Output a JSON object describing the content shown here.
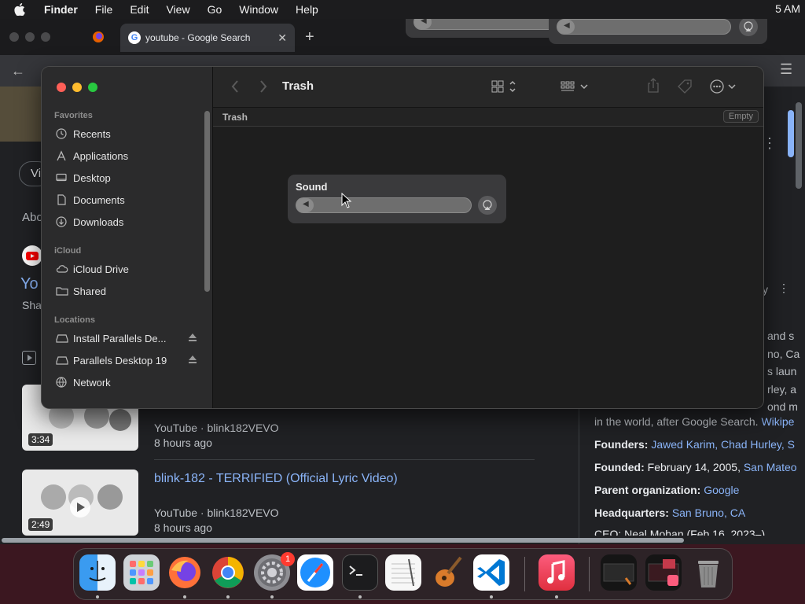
{
  "menubar": {
    "app_name": "Finder",
    "items": [
      "File",
      "Edit",
      "View",
      "Go",
      "Window",
      "Help"
    ],
    "clock": "5 AM"
  },
  "chrome": {
    "tab_title": "youtube - Google Search",
    "partial_texts": {
      "vi": "Vi",
      "abo": "Abo",
      "yo": "Yo",
      "sha": "Sha",
      "right_y": "y",
      "kp_lines": [
        "and s",
        "no, Ca",
        "s laun",
        "rley, a",
        "ond m"
      ]
    },
    "results": [
      {
        "title": "",
        "source": "YouTube · blink182VEVO",
        "age": "8 hours ago",
        "duration": "3:34"
      },
      {
        "title": "blink-182 - TERRIFIED (Official Lyric Video)",
        "source": "YouTube · blink182VEVO",
        "age": "8 hours ago",
        "duration": "2:49"
      }
    ],
    "knowledge_panel": {
      "desc_end": "in the world, after Google Search.",
      "desc_link": "Wikipe",
      "founders_label": "Founders:",
      "founders": "Jawed Karim, Chad Hurley, S",
      "founded_label": "Founded:",
      "founded": "February 14, 2005,",
      "founded_link": "San Mateo",
      "parent_label": "Parent organization:",
      "parent": "Google",
      "hq_label": "Headquarters:",
      "hq": "San Bruno, CA",
      "ceo_partial": "CEO: Neal Mohan (Feb 16, 2023–)"
    }
  },
  "finder": {
    "title": "Trash",
    "path_label": "Trash",
    "empty_button": "Empty",
    "sections": {
      "favorites": "Favorites",
      "icloud": "iCloud",
      "locations": "Locations"
    },
    "favorites": [
      "Recents",
      "Applications",
      "Desktop",
      "Documents",
      "Downloads"
    ],
    "icloud": [
      "iCloud Drive",
      "Shared"
    ],
    "locations": [
      "Install Parallels De...",
      "Parallels Desktop 19",
      "Network"
    ]
  },
  "sound": {
    "label": "Sound",
    "volume": 0.0
  },
  "dock": {
    "apps": [
      "Finder",
      "Launchpad",
      "Firefox",
      "Google Chrome",
      "System Settings",
      "Safari",
      "Terminal",
      "TextEdit",
      "GarageBand",
      "Visual Studio Code",
      "Music",
      "Recent Window",
      "Music Window",
      "Trash"
    ],
    "settings_badge": "1"
  },
  "colors": {
    "close": "#ff5f57",
    "minimize": "#febc2e",
    "zoom": "#28c840",
    "link": "#8ab4f8"
  }
}
